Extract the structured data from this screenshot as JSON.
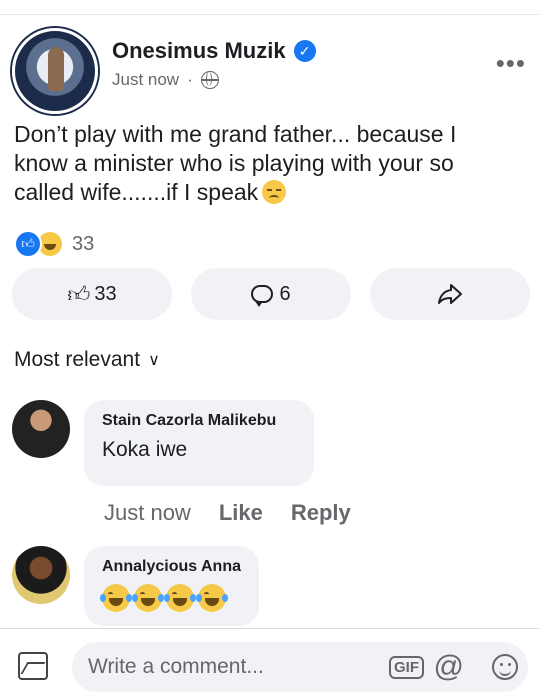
{
  "post": {
    "author": "Onesimus Muzik",
    "timestamp": "Just now",
    "separator": "·",
    "privacy_icon": "globe-icon",
    "verified_icon": "verified-badge-icon",
    "more_label": "•••",
    "text": "Don’t play with me grand father... because I know a minister who is playing with your so called wife.......if I speak",
    "reaction_count": "33",
    "reaction_icons": [
      "like-icon",
      "haha-icon"
    ]
  },
  "actions": {
    "like_count": "33",
    "comment_count": "6",
    "like_icon": "thumbs-up-icon",
    "comment_icon": "comment-icon",
    "share_icon": "share-arrow-icon"
  },
  "sort": {
    "label": "Most relevant"
  },
  "comments": [
    {
      "author": "Stain Cazorla Malikebu",
      "text": "Koka iwe",
      "time": "Just now",
      "like_label": "Like",
      "reply_label": "Reply"
    },
    {
      "author": "Annalycious Anna",
      "emoji": "laughing-tears-icon",
      "emoji_count": 4
    }
  ],
  "composer": {
    "placeholder": "Write a comment...",
    "gif_label": "GIF",
    "mention_label": "@"
  },
  "colors": {
    "accent": "#1877f2",
    "bubble_bg": "#f0f2f5",
    "muted_text": "#65676b"
  }
}
